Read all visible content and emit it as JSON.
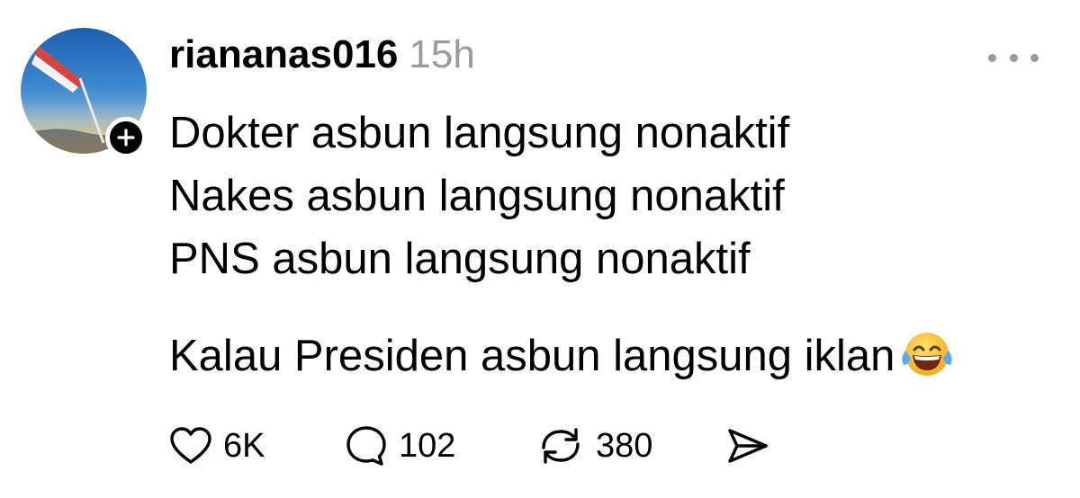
{
  "post": {
    "username": "riananas016",
    "timestamp": "15h",
    "lines": [
      "Dokter asbun langsung nonaktif",
      "Nakes asbun langsung nonaktif",
      "PNS asbun langsung nonaktif"
    ],
    "closing_line": "Kalau Presiden asbun langsung iklan",
    "emoji": "face-with-tears-of-joy"
  },
  "actions": {
    "likes": "6K",
    "replies": "102",
    "reposts": "380"
  },
  "icons": {
    "like": "heart-icon",
    "reply": "speech-bubble-icon",
    "repost": "repost-arrows-icon",
    "share": "send-icon",
    "more": "more-dots-icon",
    "follow": "plus-icon"
  },
  "colors": {
    "text": "#000000",
    "muted": "#9a9a9a",
    "background": "#ffffff"
  }
}
